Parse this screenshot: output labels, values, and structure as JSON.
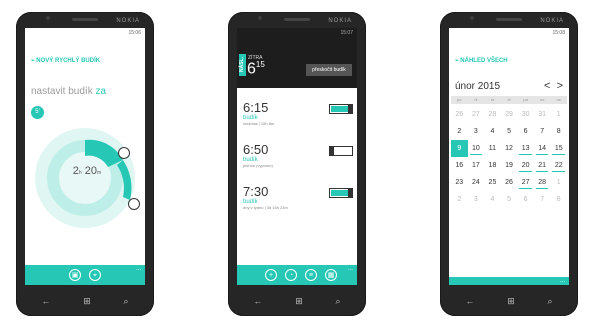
{
  "brand": "NOKIA",
  "colors": {
    "accent": "#27c7b5",
    "phone": "#262626"
  },
  "phone1": {
    "time": "15:06",
    "title": "NOVÝ RYCHLÝ BUDÍK",
    "prompt": "nastavit budík",
    "prompt_accent": "za",
    "badge": "5'",
    "dial_hours": "2",
    "dial_unit_h": "h",
    "dial_minutes": "20",
    "dial_unit_m": "m",
    "appbar_icons": [
      "save-icon",
      "pin-icon"
    ],
    "more": "..."
  },
  "phone2": {
    "time": "15:07",
    "tag": "NÁSL.",
    "label": "ZÍTRA",
    "next_hour": "6",
    "next_min": "15",
    "skip": "přeskočit budík",
    "alarms": [
      {
        "time": "6:15",
        "name": "budík",
        "detail": "mezičas | 15h 8m",
        "on": true
      },
      {
        "time": "6:50",
        "name": "budík",
        "detail": "jednou (vypnuto)",
        "on": false
      },
      {
        "time": "7:30",
        "name": "budík",
        "detail": "dny v týdnu | 3d 16h 23m",
        "on": true
      }
    ],
    "appbar_icons": [
      "add-icon",
      "alarm-icon",
      "list-icon",
      "calendar-icon"
    ],
    "more": "..."
  },
  "phone3": {
    "time": "15:08",
    "title": "NÁHLED VŠECH",
    "month": "únor 2015",
    "prev": "<",
    "next": ">",
    "weekdays": [
      "po",
      "út",
      "st",
      "čt",
      "pá",
      "so",
      "ne"
    ],
    "weeks": [
      [
        {
          "d": "26",
          "m": 1
        },
        {
          "d": "27",
          "m": 1
        },
        {
          "d": "28",
          "m": 1
        },
        {
          "d": "29",
          "m": 1
        },
        {
          "d": "30",
          "m": 1
        },
        {
          "d": "31",
          "m": 1
        },
        {
          "d": "1",
          "m": 1
        }
      ],
      [
        {
          "d": "2"
        },
        {
          "d": "3"
        },
        {
          "d": "4"
        },
        {
          "d": "5"
        },
        {
          "d": "6"
        },
        {
          "d": "7"
        },
        {
          "d": "8"
        }
      ],
      [
        {
          "d": "9",
          "t": 1
        },
        {
          "d": "10",
          "k": 1
        },
        {
          "d": "11"
        },
        {
          "d": "12"
        },
        {
          "d": "13",
          "k": 1
        },
        {
          "d": "14",
          "k": 1
        },
        {
          "d": "15",
          "k": 1
        }
      ],
      [
        {
          "d": "16"
        },
        {
          "d": "17"
        },
        {
          "d": "18"
        },
        {
          "d": "19"
        },
        {
          "d": "20",
          "k": 1
        },
        {
          "d": "21",
          "k": 1
        },
        {
          "d": "22",
          "k": 1
        }
      ],
      [
        {
          "d": "23"
        },
        {
          "d": "24"
        },
        {
          "d": "25"
        },
        {
          "d": "26"
        },
        {
          "d": "27",
          "k": 1
        },
        {
          "d": "28",
          "k": 1
        },
        {
          "d": "1",
          "m": 1
        }
      ],
      [
        {
          "d": "2",
          "m": 1
        },
        {
          "d": "3",
          "m": 1
        },
        {
          "d": "4",
          "m": 1
        },
        {
          "d": "5",
          "m": 1
        },
        {
          "d": "6",
          "m": 1
        },
        {
          "d": "7",
          "m": 1
        },
        {
          "d": "8",
          "m": 1
        }
      ]
    ],
    "more": "..."
  }
}
